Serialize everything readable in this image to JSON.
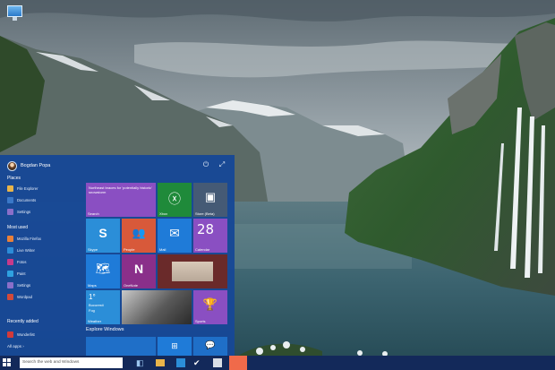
{
  "start_menu": {
    "user": {
      "name": "Bogdan Popa"
    },
    "places": {
      "title": "Places",
      "items": [
        {
          "label": "File Explorer",
          "icon": "folder-icon",
          "color": "#e8b44a"
        },
        {
          "label": "Documents",
          "icon": "documents-icon",
          "color": "#3a78c8"
        },
        {
          "label": "Settings",
          "icon": "gear-icon",
          "color": "#8a6fc9"
        }
      ]
    },
    "most_used": {
      "title": "Most used",
      "items": [
        {
          "label": "Mozilla Firefox",
          "icon": "firefox-icon",
          "color": "#e8803a"
        },
        {
          "label": "Live Writer",
          "icon": "writer-icon",
          "color": "#2c8cd8"
        },
        {
          "label": "Fotos",
          "icon": "photos-icon",
          "color": "#c63a8a"
        },
        {
          "label": "Paint",
          "icon": "paint-icon",
          "color": "#2fa1e0"
        },
        {
          "label": "Settings",
          "icon": "gear-icon",
          "color": "#8a6fc9"
        },
        {
          "label": "Wordpad",
          "icon": "wordpad-icon",
          "color": "#d24a3a"
        }
      ]
    },
    "recently_added": {
      "title": "Recently added",
      "items": [
        {
          "label": "Wunderlist",
          "icon": "wunderlist-icon",
          "color": "#d23a3a"
        }
      ]
    },
    "all_apps": "All apps ›",
    "tiles": {
      "search_text": "Northeast braces for 'potentially historic' snowstorm",
      "search_label": "Search",
      "xbox": "Xbox",
      "store": "Store (Beta)",
      "skype": "Skype",
      "people": "People",
      "mail": "Mail",
      "calendar_number": "28",
      "calendar": "Calendar",
      "maps": "Maps",
      "onenote": "OneNote",
      "weather_temp": "1°",
      "weather_place": "Bucuresti",
      "weather_desc": "Fog",
      "weather": "Weather",
      "sports": "Sports"
    },
    "explore": "Explore Windows"
  },
  "taskbar": {
    "search_placeholder": "Search the web and Windows"
  }
}
